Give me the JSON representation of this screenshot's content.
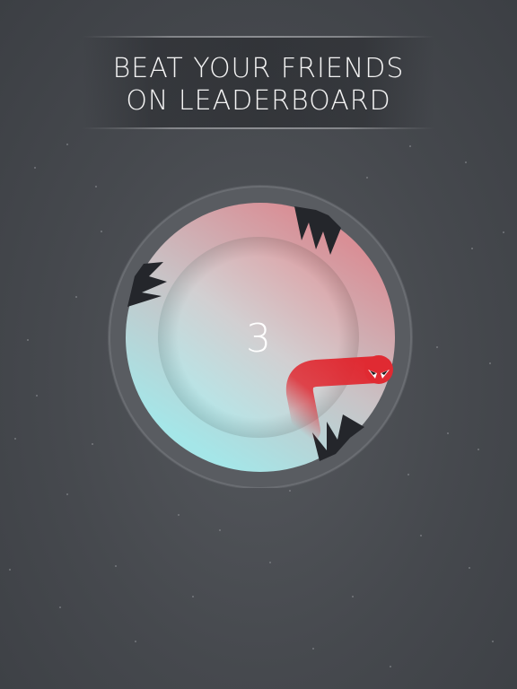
{
  "banner": {
    "line1": "BEAT YOUR FRIENDS",
    "line2": "ON LEADERBOARD"
  },
  "game": {
    "score": "3",
    "ring_gradient": {
      "warm": "#d98f96",
      "cool": "#a5e6e8"
    },
    "outer_ring": "#595c61",
    "snake_color": "#e02a32",
    "spike_color": "#24262b"
  }
}
